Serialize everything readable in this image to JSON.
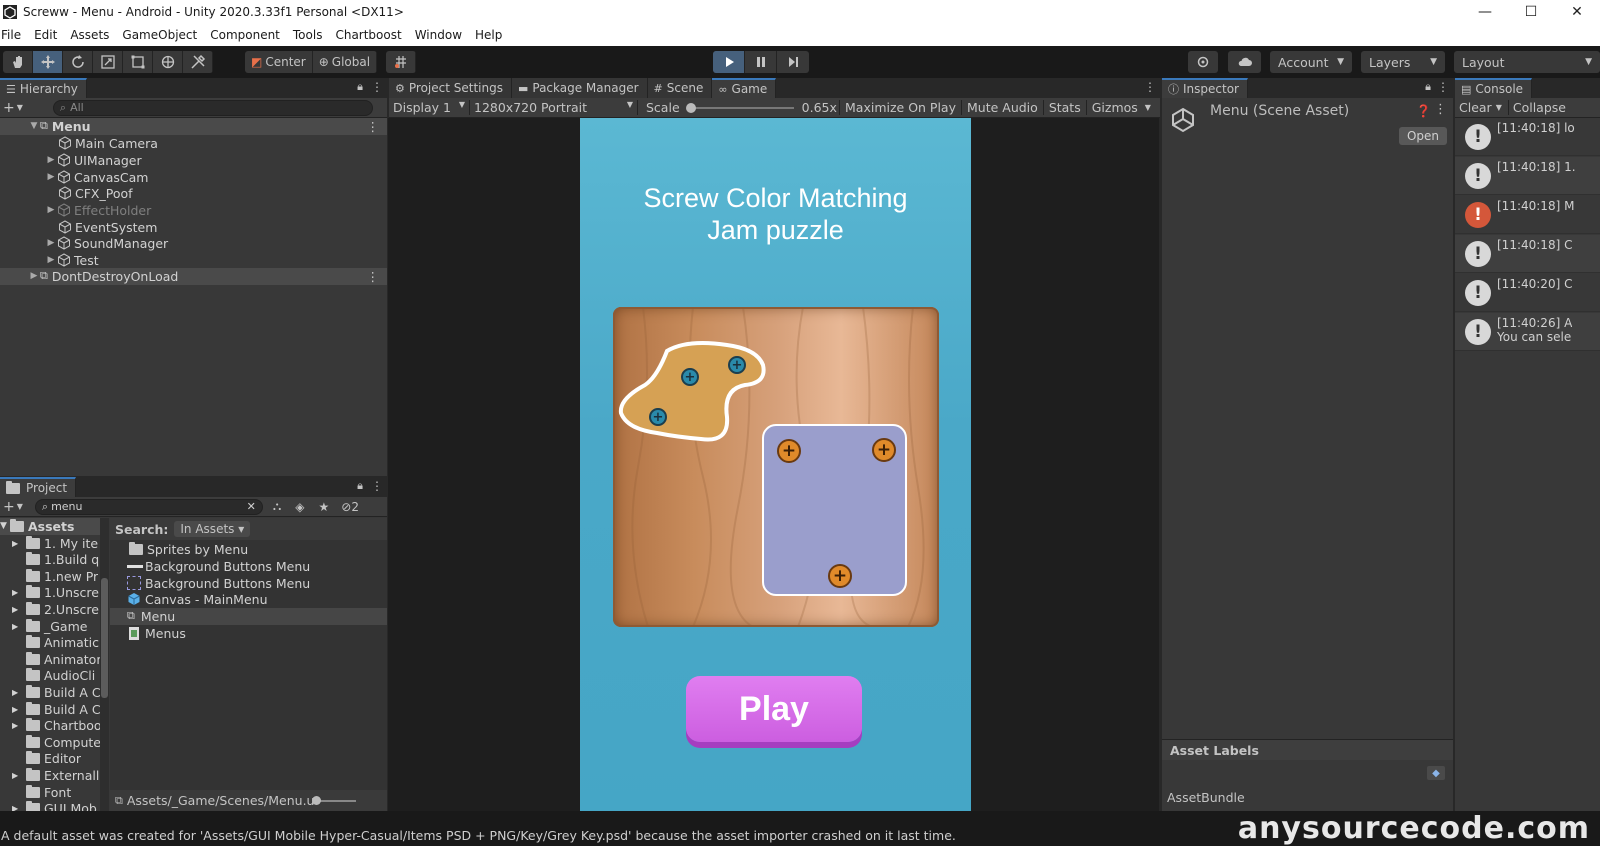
{
  "window": {
    "title": "Screww - Menu - Android - Unity 2020.3.33f1 Personal <DX11>",
    "minimize": "—",
    "maximize": "☐",
    "close": "✕"
  },
  "menubar": [
    "File",
    "Edit",
    "Assets",
    "GameObject",
    "Component",
    "Tools",
    "Chartboost",
    "Window",
    "Help"
  ],
  "toolbar": {
    "pivot_label": "Center",
    "space_label": "Global",
    "account_label": "Account",
    "layers_label": "Layers",
    "layout_label": "Layout"
  },
  "hierarchy": {
    "tab_label": "Hierarchy",
    "search_placeholder": "All",
    "rows": [
      {
        "label": "Menu"
      },
      {
        "label": "Main Camera"
      },
      {
        "label": "UIManager"
      },
      {
        "label": "CanvasCam"
      },
      {
        "label": "CFX_Poof"
      },
      {
        "label": "EffectHolder"
      },
      {
        "label": "EventSystem"
      },
      {
        "label": "SoundManager"
      },
      {
        "label": "Test"
      },
      {
        "label": "DontDestroyOnLoad"
      }
    ]
  },
  "project": {
    "tab_label": "Project",
    "search_value": "menu",
    "hidden_count": "2",
    "search_label": "Search:",
    "scope_label": "In Assets",
    "tree": [
      "Assets",
      "1. My ite",
      "1.Build q",
      "1.new Pr",
      "1.Unscre",
      "2.Unscre",
      "_Game",
      "Animatic",
      "Animator",
      "AudioCli",
      "Build A C",
      "Build A C",
      "Chartboo",
      "Compute",
      "Editor",
      "Externall",
      "Font",
      "GUI Mob"
    ],
    "results": [
      "Sprites by Menu",
      "Background Buttons Menu",
      "Background Buttons Menu",
      "Canvas - MainMenu",
      "Menu",
      "Menus"
    ],
    "path": "Assets/_Game/Scenes/Menu.u"
  },
  "center_tabs": [
    "Project Settings",
    "Package Manager",
    "Scene",
    "Game"
  ],
  "game_toolbar": {
    "display": "Display 1",
    "resolution": "1280x720 Portrait",
    "scale_label": "Scale",
    "scale_value": "0.65x",
    "maximize": "Maximize On Play",
    "mute": "Mute Audio",
    "stats": "Stats",
    "gizmos": "Gizmos"
  },
  "game": {
    "title": "Screw Color Matching\nJam puzzle",
    "play_button": "Play"
  },
  "inspector": {
    "tab_label": "Inspector",
    "asset_name": "Menu (Scene Asset)",
    "open_button": "Open",
    "asset_labels": "Asset Labels",
    "asset_bundle": "AssetBundle"
  },
  "console": {
    "tab_label": "Console",
    "clear": "Clear",
    "collapse": "Collapse",
    "rows": [
      {
        "text": "[11:40:18] lo",
        "type": "warn"
      },
      {
        "text": "[11:40:18] 1.",
        "type": "warn"
      },
      {
        "text": "[11:40:18] M",
        "type": "err"
      },
      {
        "text": "[11:40:18] C",
        "type": "warn"
      },
      {
        "text": "[11:40:20] C",
        "type": "warn"
      },
      {
        "text": "[11:40:26] A\nYou can sele",
        "type": "warn"
      }
    ]
  },
  "status": {
    "message": "A default asset was created for 'Assets/GUI Mobile Hyper-Casual/Items PSD + PNG/Key/Grey Key.psd' because the asset importer crashed on it last time.",
    "watermark": "anysourcecode.com"
  },
  "colors": {
    "accent_blue": "#3a79bb",
    "play_active": "#46607c",
    "game_bg": "#4aa8c8",
    "play_button": "#d56ce8",
    "error_icon": "#d4573a"
  }
}
